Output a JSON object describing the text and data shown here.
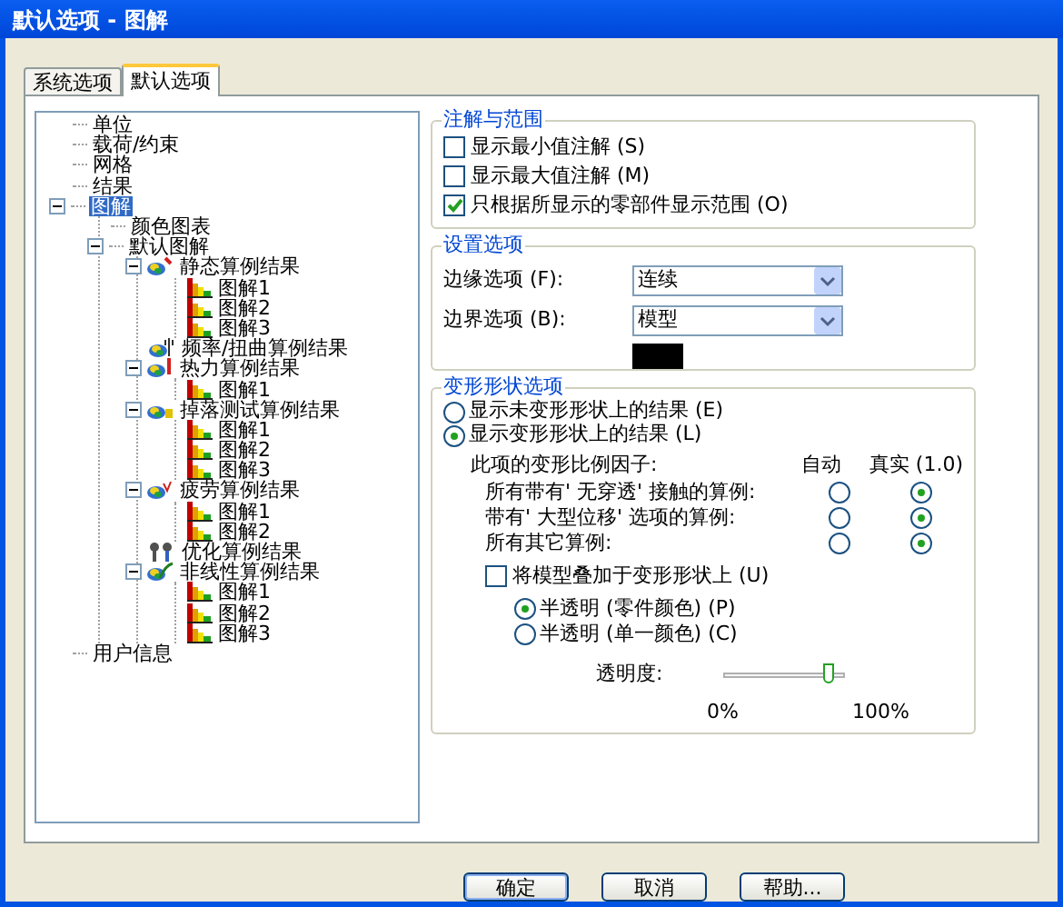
{
  "window": {
    "title": "默认选项 - 图解"
  },
  "tabs": [
    {
      "label": "系统选项",
      "selected": false
    },
    {
      "label": "默认选项",
      "selected": true
    }
  ],
  "tree": [
    {
      "label": "单位",
      "selected": false
    },
    {
      "label": "载荷/约束",
      "selected": false
    },
    {
      "label": "网格",
      "selected": false
    },
    {
      "label": "结果",
      "selected": false
    },
    {
      "label": "图解",
      "selected": true,
      "expanded": true,
      "children": [
        {
          "label": "颜色图表",
          "selected": false
        },
        {
          "label": "默认图解",
          "selected": false,
          "expanded": true,
          "children": [
            {
              "label": "静态算例结果",
              "kind": "static",
              "selected": false,
              "expanded": true,
              "children": [
                {
                  "label": "图解1",
                  "kind": "plot",
                  "selected": false
                },
                {
                  "label": "图解2",
                  "kind": "plot",
                  "selected": false
                },
                {
                  "label": "图解3",
                  "kind": "plot",
                  "selected": false
                }
              ]
            },
            {
              "label": "频率/扭曲算例结果",
              "kind": "frequency",
              "selected": false
            },
            {
              "label": "热力算例结果",
              "kind": "thermal",
              "selected": false,
              "expanded": true,
              "children": [
                {
                  "label": "图解1",
                  "kind": "plot",
                  "selected": false
                }
              ]
            },
            {
              "label": "掉落测试算例结果",
              "kind": "drop",
              "selected": false,
              "expanded": true,
              "children": [
                {
                  "label": "图解1",
                  "kind": "plot",
                  "selected": false
                },
                {
                  "label": "图解2",
                  "kind": "plot",
                  "selected": false
                },
                {
                  "label": "图解3",
                  "kind": "plot",
                  "selected": false
                }
              ]
            },
            {
              "label": "疲劳算例结果",
              "kind": "fatigue",
              "selected": false,
              "expanded": true,
              "children": [
                {
                  "label": "图解1",
                  "kind": "plot",
                  "selected": false
                },
                {
                  "label": "图解2",
                  "kind": "plot",
                  "selected": false
                }
              ]
            },
            {
              "label": "优化算例结果",
              "kind": "optimize",
              "selected": false
            },
            {
              "label": "非线性算例结果",
              "kind": "nonlinear",
              "selected": false,
              "expanded": true,
              "children": [
                {
                  "label": "图解1",
                  "kind": "plot",
                  "selected": false
                },
                {
                  "label": "图解2",
                  "kind": "plot",
                  "selected": false
                },
                {
                  "label": "图解3",
                  "kind": "plot",
                  "selected": false
                }
              ]
            }
          ]
        }
      ]
    },
    {
      "label": "用户信息",
      "selected": false
    }
  ],
  "annotation_group": {
    "title": "注解与范围",
    "options": [
      {
        "label": "显示最小值注解 (S)",
        "checked": false
      },
      {
        "label": "显示最大值注解 (M)",
        "checked": false
      },
      {
        "label": "只根据所显示的零部件显示范围 (O)",
        "checked": true
      }
    ]
  },
  "settings_group": {
    "title": "设置选项",
    "fields": [
      {
        "label": "边缘选项 (F):",
        "value": "连续"
      },
      {
        "label": "边界选项 (B):",
        "value": "模型"
      }
    ],
    "swatch": {
      "color": "#000000"
    }
  },
  "deform_group": {
    "title": "变形形状选项",
    "modes": [
      {
        "label": "显示未变形形状上的结果 (E)",
        "selected": false
      },
      {
        "label": "显示变形形状上的结果 (L)",
        "selected": true
      }
    ],
    "scale_heading": "此项的变形比例因子:",
    "columns": [
      "自动",
      "真实 (1.0)"
    ],
    "scale_rows": [
      {
        "label": "所有带有' 无穿透' 接触的算例:",
        "choices": [
          {
            "selected": false
          },
          {
            "selected": true
          }
        ]
      },
      {
        "label": "带有' 大型位移' 选项的算例:",
        "choices": [
          {
            "selected": false
          },
          {
            "selected": true
          }
        ]
      },
      {
        "label": "所有其它算例:",
        "choices": [
          {
            "selected": false
          },
          {
            "selected": true
          }
        ]
      }
    ],
    "overlay": {
      "label": "将模型叠加于变形形状上 (U)",
      "checked": false
    },
    "overlay_modes": [
      {
        "label": "半透明 (零件颜色) (P)",
        "selected": true
      },
      {
        "label": "半透明 (单一颜色) (C)",
        "selected": false
      }
    ],
    "transparency": {
      "label": "透明度:",
      "level": 0.88,
      "min_label": "0%",
      "max_label": "100%"
    }
  },
  "buttons": [
    "确定",
    "取消",
    "帮助..."
  ]
}
